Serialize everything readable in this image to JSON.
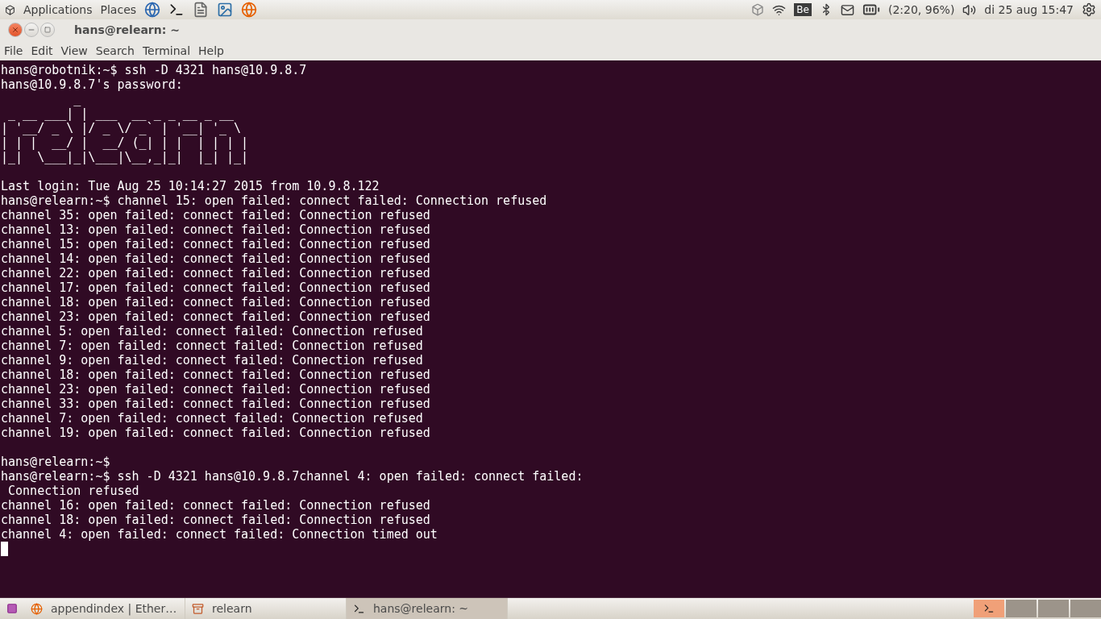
{
  "top_panel": {
    "menus": [
      "Applications",
      "Places"
    ],
    "launchers": [
      {
        "kind": "mail"
      },
      {
        "kind": "terminal"
      },
      {
        "kind": "editor"
      },
      {
        "kind": "office"
      },
      {
        "kind": "browser"
      }
    ],
    "keyboard_layout": "Be",
    "battery": "(2:20, 96%)",
    "clock": "di 25 aug 15:47"
  },
  "window": {
    "title": "hans@relearn: ~",
    "menu": [
      "File",
      "Edit",
      "View",
      "Search",
      "Terminal",
      "Help"
    ]
  },
  "terminal": {
    "blocks": [
      {
        "kind": "lines",
        "lines": [
          "hans@robotnik:~$ ssh -D 4321 hans@10.9.8.7",
          "hans@10.9.8.7's password:"
        ]
      },
      {
        "kind": "banner",
        "art": "          _\n _ __ ___| | ___  __ _ _ __ _ __\n| '__/ _ \\ |/ _ \\/ _` | '__| '_ \\\n| | |  __/ |  __/ (_| | |  | | | |\n|_|  \\___|_|\\___|\\__,_|_|  |_| |_|"
      },
      {
        "kind": "gap"
      },
      {
        "kind": "lines",
        "lines": [
          "Last login: Tue Aug 25 10:14:27 2015 from 10.9.8.122",
          "hans@relearn:~$ channel 15: open failed: connect failed: Connection refused",
          "channel 35: open failed: connect failed: Connection refused",
          "channel 13: open failed: connect failed: Connection refused",
          "channel 15: open failed: connect failed: Connection refused",
          "channel 14: open failed: connect failed: Connection refused",
          "channel 22: open failed: connect failed: Connection refused",
          "channel 17: open failed: connect failed: Connection refused",
          "channel 18: open failed: connect failed: Connection refused",
          "channel 23: open failed: connect failed: Connection refused",
          "channel 5: open failed: connect failed: Connection refused",
          "channel 7: open failed: connect failed: Connection refused",
          "channel 9: open failed: connect failed: Connection refused",
          "channel 18: open failed: connect failed: Connection refused",
          "channel 23: open failed: connect failed: Connection refused",
          "channel 33: open failed: connect failed: Connection refused",
          "channel 7: open failed: connect failed: Connection refused",
          "channel 19: open failed: connect failed: Connection refused"
        ]
      },
      {
        "kind": "gap"
      },
      {
        "kind": "lines",
        "lines": [
          "hans@relearn:~$",
          "hans@relearn:~$ ssh -D 4321 hans@10.9.8.7channel 4: open failed: connect failed:",
          " Connection refused",
          "channel 16: open failed: connect failed: Connection refused",
          "channel 18: open failed: connect failed: Connection refused",
          "channel 4: open failed: connect failed: Connection timed out"
        ]
      },
      {
        "kind": "cursor"
      }
    ]
  },
  "taskbar": {
    "tasks": [
      {
        "label": "appendindex | Ether…",
        "kind": "browser",
        "selected": false
      },
      {
        "label": "relearn",
        "kind": "files",
        "selected": false
      },
      {
        "label": "hans@relearn: ~",
        "kind": "terminal",
        "selected": true
      }
    ],
    "workspaces": [
      {
        "selected": true
      },
      {
        "selected": false
      },
      {
        "selected": false
      },
      {
        "selected": false
      }
    ]
  }
}
